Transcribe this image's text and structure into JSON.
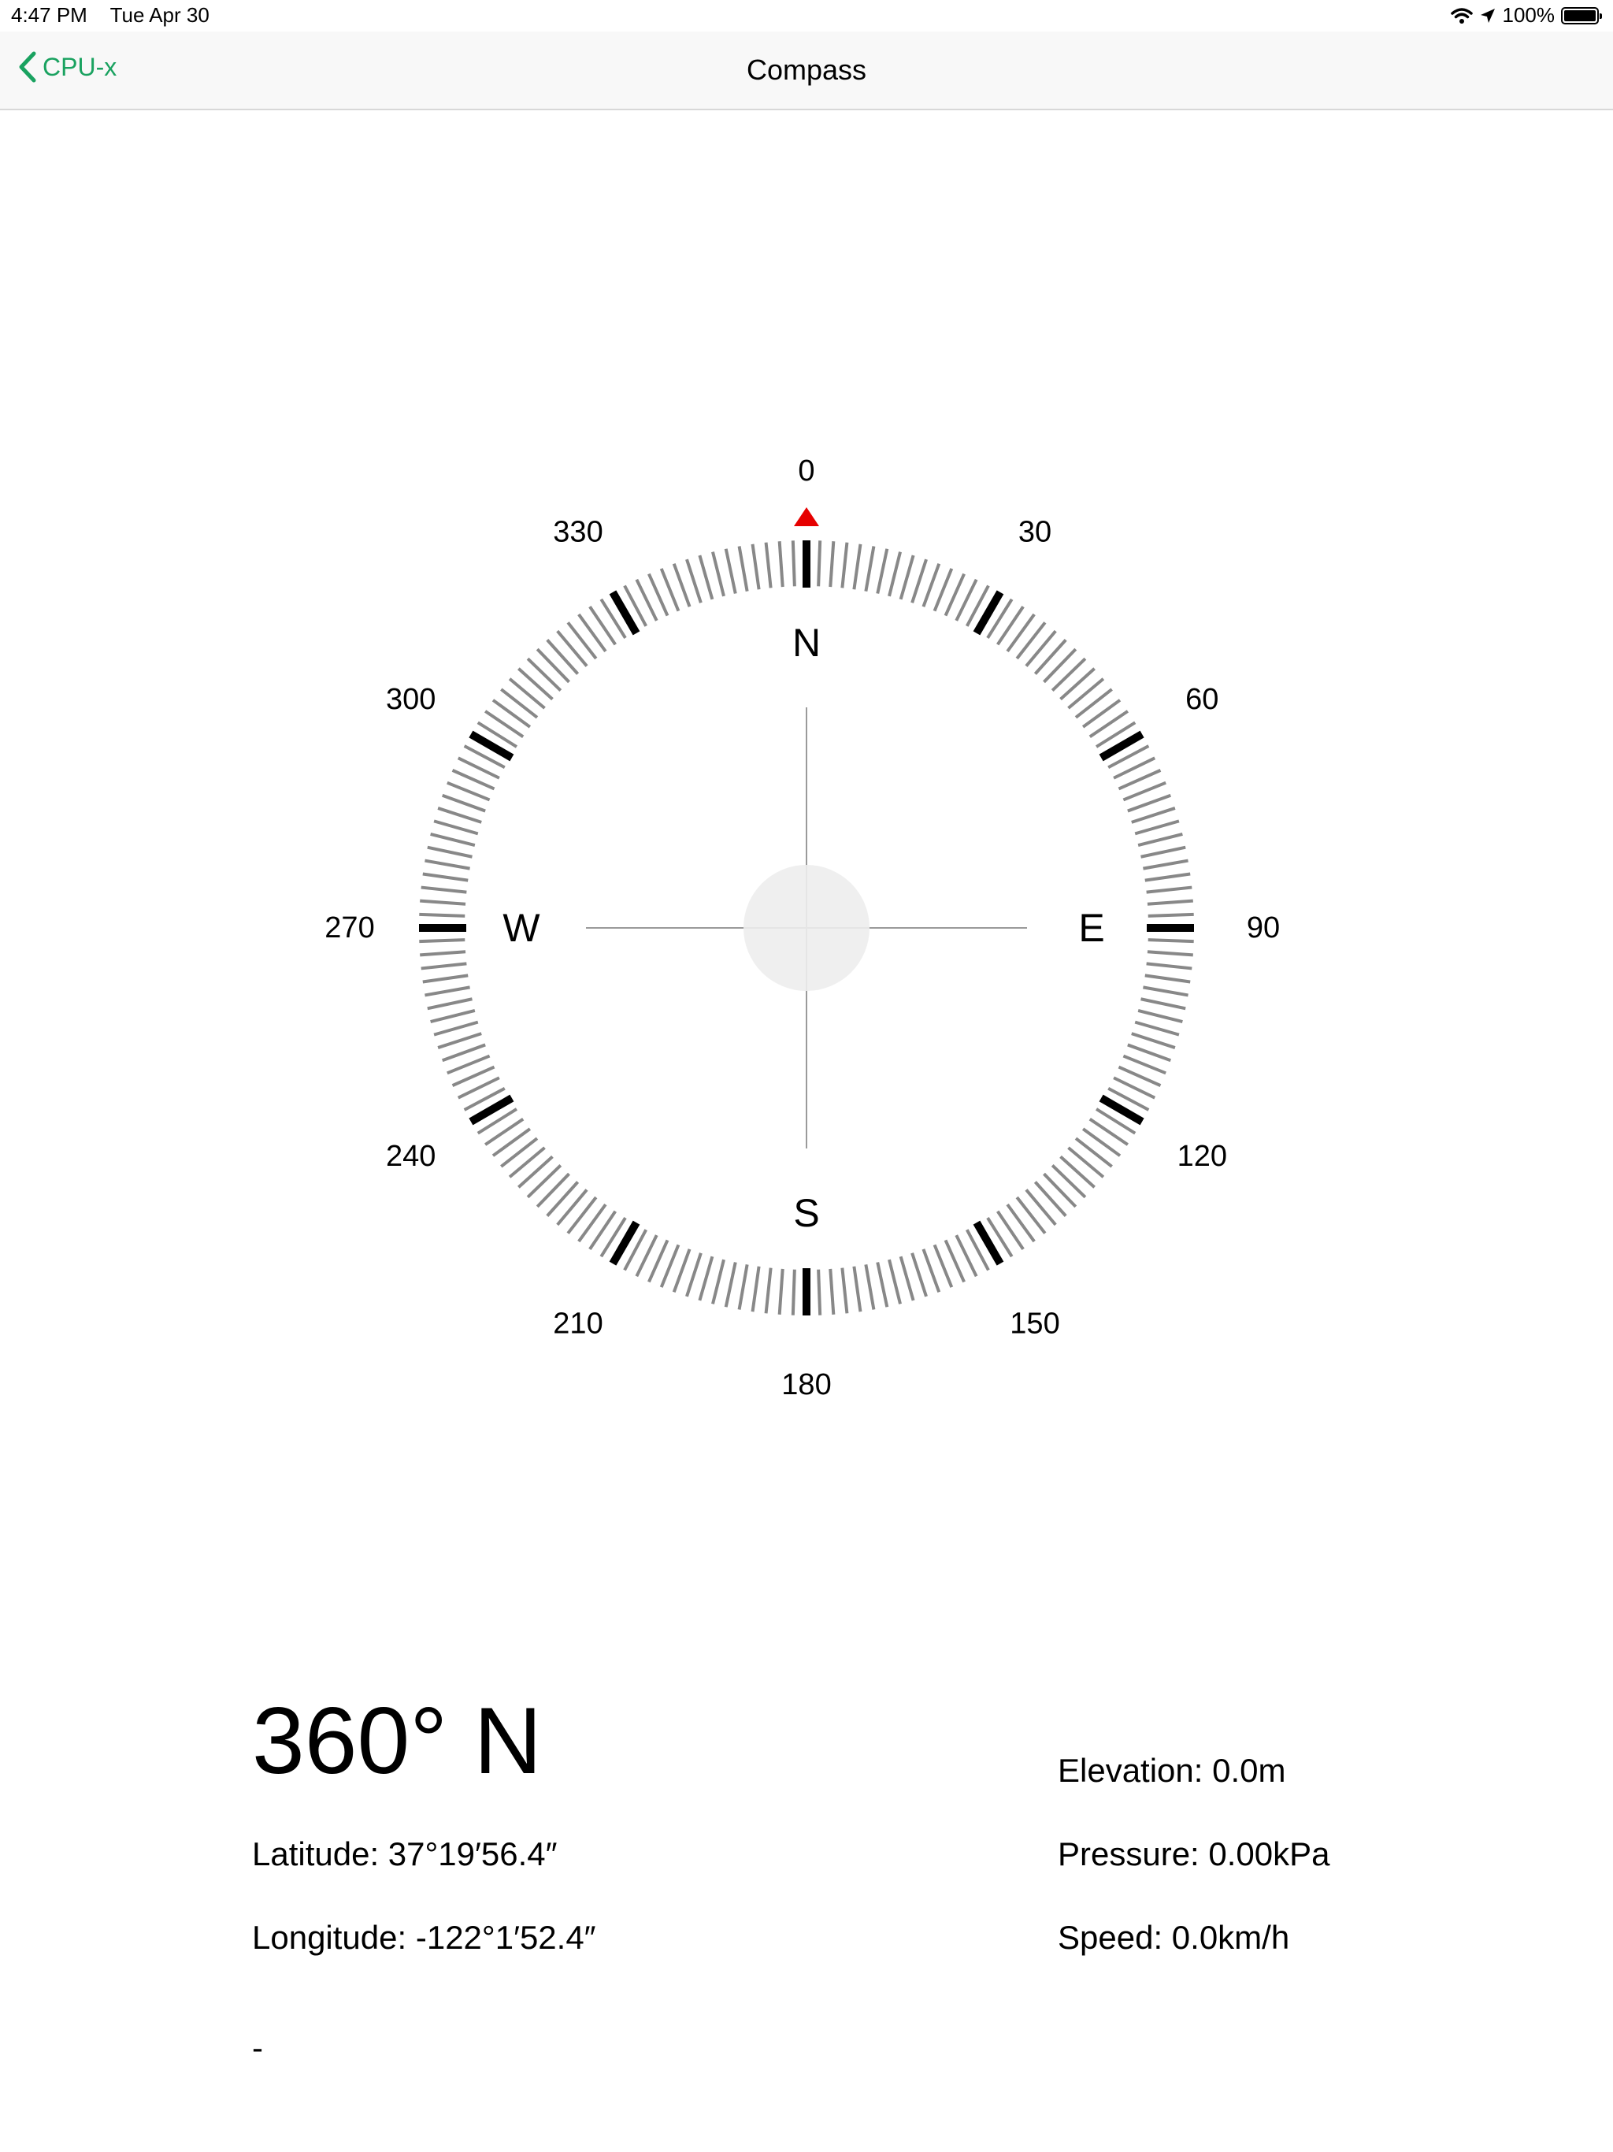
{
  "status_bar": {
    "time": "4:47 PM",
    "date": "Tue Apr 30",
    "wifi_icon": "wifi-icon",
    "location_icon": "location-arrow-icon",
    "battery_text": "100%",
    "battery_level": 1.0
  },
  "nav": {
    "back_label": "CPU-x",
    "back_icon": "chevron-left-icon",
    "title": "Compass",
    "accent_color": "#1aa260"
  },
  "compass": {
    "heading_degrees": 360,
    "degree_labels": [
      "0",
      "30",
      "60",
      "90",
      "120",
      "150",
      "180",
      "210",
      "240",
      "270",
      "300",
      "330"
    ],
    "cardinals": [
      "N",
      "E",
      "S",
      "W"
    ],
    "indicator_color": "#e60000",
    "major_tick_color": "#000000",
    "minor_tick_color": "#888888"
  },
  "readout": {
    "heading": "360° N",
    "latitude": "Latitude: 37°19′56.4″",
    "longitude": "Longitude: -122°1′52.4″",
    "elevation": "Elevation: 0.0m",
    "pressure": "Pressure: 0.00kPa",
    "speed": "Speed: 0.0km/h",
    "footer": "-"
  }
}
